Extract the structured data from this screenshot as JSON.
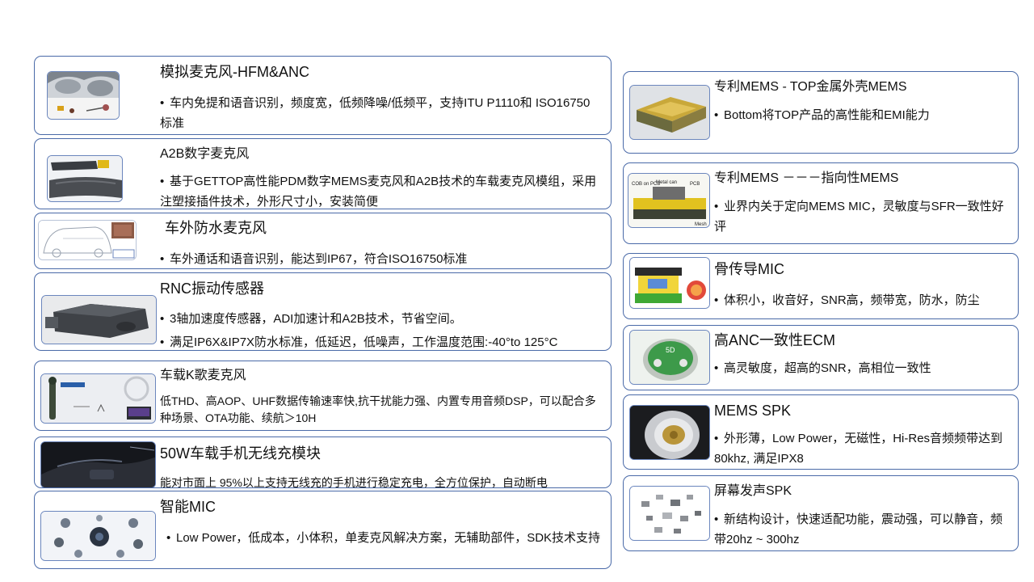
{
  "left": [
    {
      "title": "模拟麦克风-HFM&ANC",
      "bullets": [
        "车内免提和语音识别，频度宽，低频降噪/低频平，支持ITU P1110和 ISO16750标准"
      ],
      "image": "car-interior-microphone-photo"
    },
    {
      "title": "A2B数字麦克风",
      "bullets": [
        "基于GETTOP高性能PDM数字MEMS麦克风和A2B技术的车载麦克风模组，采用注塑接插件技术，外形尺寸小，安装简便"
      ],
      "image": "car-mirror-module-photo"
    },
    {
      "title": "车外防水麦克风",
      "bullets": [
        "车外通话和语音识别，能达到IP67，符合ISO16750标准"
      ],
      "image": "car-outline-diagram"
    },
    {
      "title": "RNC振动传感器",
      "bullets": [
        "3轴加速度传感器，ADI加速计和A2B技术，节省空间。",
        "满足IP6X&IP7X防水标准，低延迟，低噪声，工作温度范围:-40°to 125°C"
      ],
      "image": "vibration-sensor-photo"
    },
    {
      "title": "车载K歌麦克风",
      "bullets": [
        "低THD、高AOP、UHF数据传输速率快,抗干扰能力强、内置专用音频DSP，可以配合多种场景、OTA功能、续航＞10H"
      ],
      "image": "karaoke-mic-photo"
    },
    {
      "title": "50W车载手机无线充模块",
      "bullets": [
        "能对市面上 95%以上支持无线充的手机进行稳定充电，全方位保护，自动断电"
      ],
      "image": "wireless-charger-console-photo"
    },
    {
      "title": "智能MIC",
      "bullets": [
        "Low Power，低成本，小体积，单麦克风解决方案，无辅助部件，SDK技术支持"
      ],
      "image": "smart-mic-diagram"
    }
  ],
  "right": [
    {
      "title": "专利MEMS - TOP金属外壳MEMS",
      "bullets": [
        "Bottom将TOP产品的高性能和EMI能力"
      ],
      "image": "mems-metal-can-photo"
    },
    {
      "title": "专利MEMS －－－指向性MEMS",
      "bullets": [
        "业界内关于定向MEMS MIC，灵敏度与SFR一致性好评"
      ],
      "image": "directional-mems-diagram",
      "image_labels": [
        "COB on PCB",
        "Metal can",
        "PCB",
        "Mesh"
      ]
    },
    {
      "title": "骨传导MIC",
      "bullets": [
        "体积小，收音好，SNR高，频带宽，防水，防尘"
      ],
      "image": "bone-conduction-diagram"
    },
    {
      "title": "高ANC一致性ECM",
      "bullets": [
        "高灵敏度，超高的SNR，高相位一致性"
      ],
      "image": "ecm-capsule-photo",
      "image_labels": [
        "5D"
      ]
    },
    {
      "title": "MEMS SPK",
      "bullets": [
        "外形薄，Low Power，无磁性，Hi-Res音频频带达到80khz, 满足IPX8"
      ],
      "image": "mems-speaker-photo"
    },
    {
      "title": "屏幕发声SPK",
      "bullets": [
        "新结构设计，快速适配功能，震动强，可以静音，频带20hz ~ 300hz"
      ],
      "image": "screen-speaker-chips-photo"
    }
  ],
  "colors": {
    "border": "#4a6aa8",
    "thumb_border": "#6b86bd"
  }
}
